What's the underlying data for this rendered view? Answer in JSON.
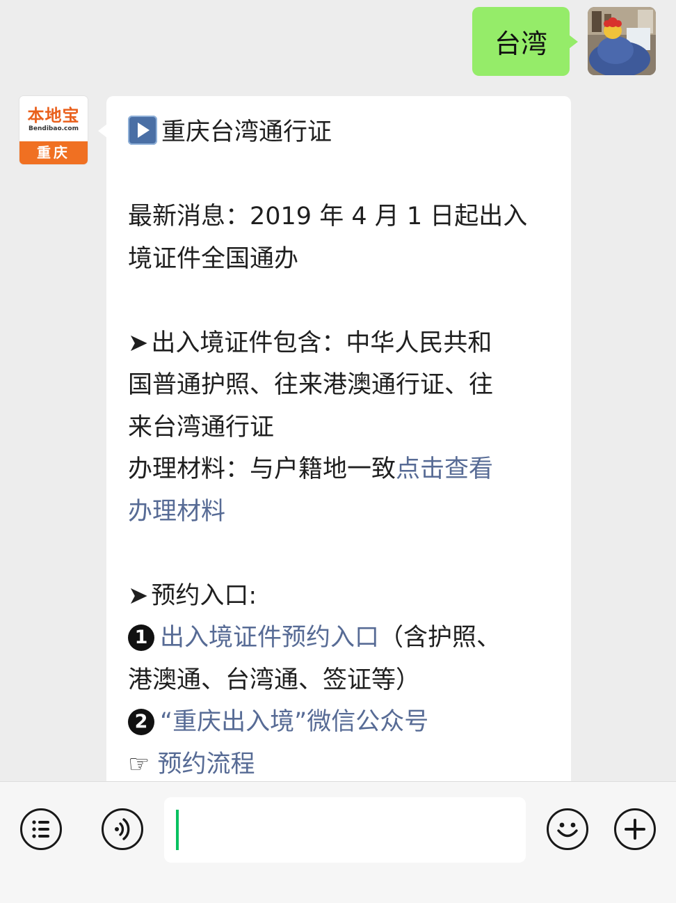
{
  "chat": {
    "outgoing_message": "台湾",
    "bot_avatar": {
      "logo_text": "本地宝",
      "logo_sub": "Bendibao.com",
      "city": "重庆"
    },
    "incoming": {
      "title": "重庆台湾通行证",
      "news_line1": "最新消息：2019 年 4 月 1 日起出入",
      "news_line2": "境证件全国通办",
      "arrow1": "➤",
      "docs_line1": "出入境证件包含：中华人民共和",
      "docs_line2": "国普通护照、往来港澳通行证、往",
      "docs_line3": "来台湾通行证",
      "materials_prefix": "办理材料：与户籍地一致",
      "materials_link_part1": "点击查看",
      "materials_link_part2": "办理材料",
      "arrow2": "➤",
      "booking_label": "预约入口:",
      "item1_num": "1",
      "item1_link": "出入境证件预约入口",
      "item1_suffix": "（含护照、",
      "item1_line2": "港澳通、台湾通、签证等）",
      "item2_num": "2",
      "item2_quote_open": "“",
      "item2_link": "重庆出入境",
      "item2_quote_close": "”",
      "item2_suffix": "微信公众号",
      "hand_icon": "☞",
      "process_link": "预约流程"
    }
  },
  "colors": {
    "chat_bg": "#ededed",
    "outgoing_bubble": "#95ec69",
    "incoming_bubble": "#ffffff",
    "link": "#576b95",
    "caret": "#07c160",
    "brand_orange": "#f07022"
  },
  "input_bar": {
    "icons": [
      "menu-list-icon",
      "voice-icon",
      "emoji-icon",
      "plus-icon"
    ]
  }
}
